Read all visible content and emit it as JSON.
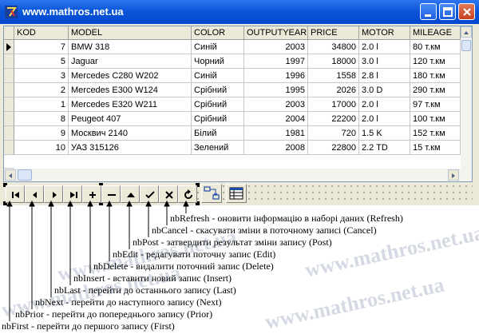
{
  "window": {
    "title": "www.mathros.net.ua"
  },
  "watermark": {
    "text": "www.mathros.net.ua"
  },
  "grid": {
    "columns": [
      "KOD",
      "MODEL",
      "COLOR",
      "OUTPUTYEAR",
      "PRICE",
      "MOTOR",
      "MILEAGE"
    ],
    "rows": [
      [
        "7",
        "BMW 318",
        "Синій",
        "2003",
        "34800",
        "2.0 l",
        "80 т.км"
      ],
      [
        "5",
        "Jaguar",
        "Чорний",
        "1997",
        "18000",
        "3.0 l",
        "120 т.км"
      ],
      [
        "3",
        "Mercedes C280 W202",
        "Синій",
        "1996",
        "1558",
        "2.8 l",
        "180 т.км"
      ],
      [
        "2",
        "Mercedes E300 W124",
        "Срібний",
        "1995",
        "2026",
        "3.0 D",
        "290 т.км"
      ],
      [
        "1",
        "Mercedes E320 W211",
        "Срібний",
        "2003",
        "17000",
        "2.0 l",
        "97 т.км"
      ],
      [
        "8",
        "Peugeot 407",
        "Срібний",
        "2004",
        "22200",
        "2.0 l",
        "100 т.км"
      ],
      [
        "9",
        "Москвич 2140",
        "Білий",
        "1981",
        "720",
        "1.5 K",
        "152 т.км"
      ],
      [
        "10",
        "УАЗ 315126",
        "Зелений",
        "2008",
        "22800",
        "2.2 TD",
        "15 т.км"
      ]
    ]
  },
  "navigator": {
    "buttons": [
      "nbFirst",
      "nbPrior",
      "nbNext",
      "nbLast",
      "nbInsert",
      "nbDelete",
      "nbEdit",
      "nbPost",
      "nbCancel",
      "nbRefresh"
    ]
  },
  "annotations": [
    "nbRefresh - оновити інформацію в наборі даних (Refresh)",
    "nbCancel - скасувати зміни в поточному записі (Cancel)",
    "nbPost - затвердити результат зміни запису (Post)",
    "nbEdit - редагувати поточну запис (Edit)",
    "nbDelete - видалити поточний запис (Delete)",
    "nbInsert - вставити новий запис (Insert)",
    "nbLast - перейти до останнього запису (Last)",
    "nbNext - перейти до наступного запису (Next)",
    "nbPrior - перейти до попереднього запису (Prior)",
    "nbFirst - перейти до першого запису (First)"
  ]
}
